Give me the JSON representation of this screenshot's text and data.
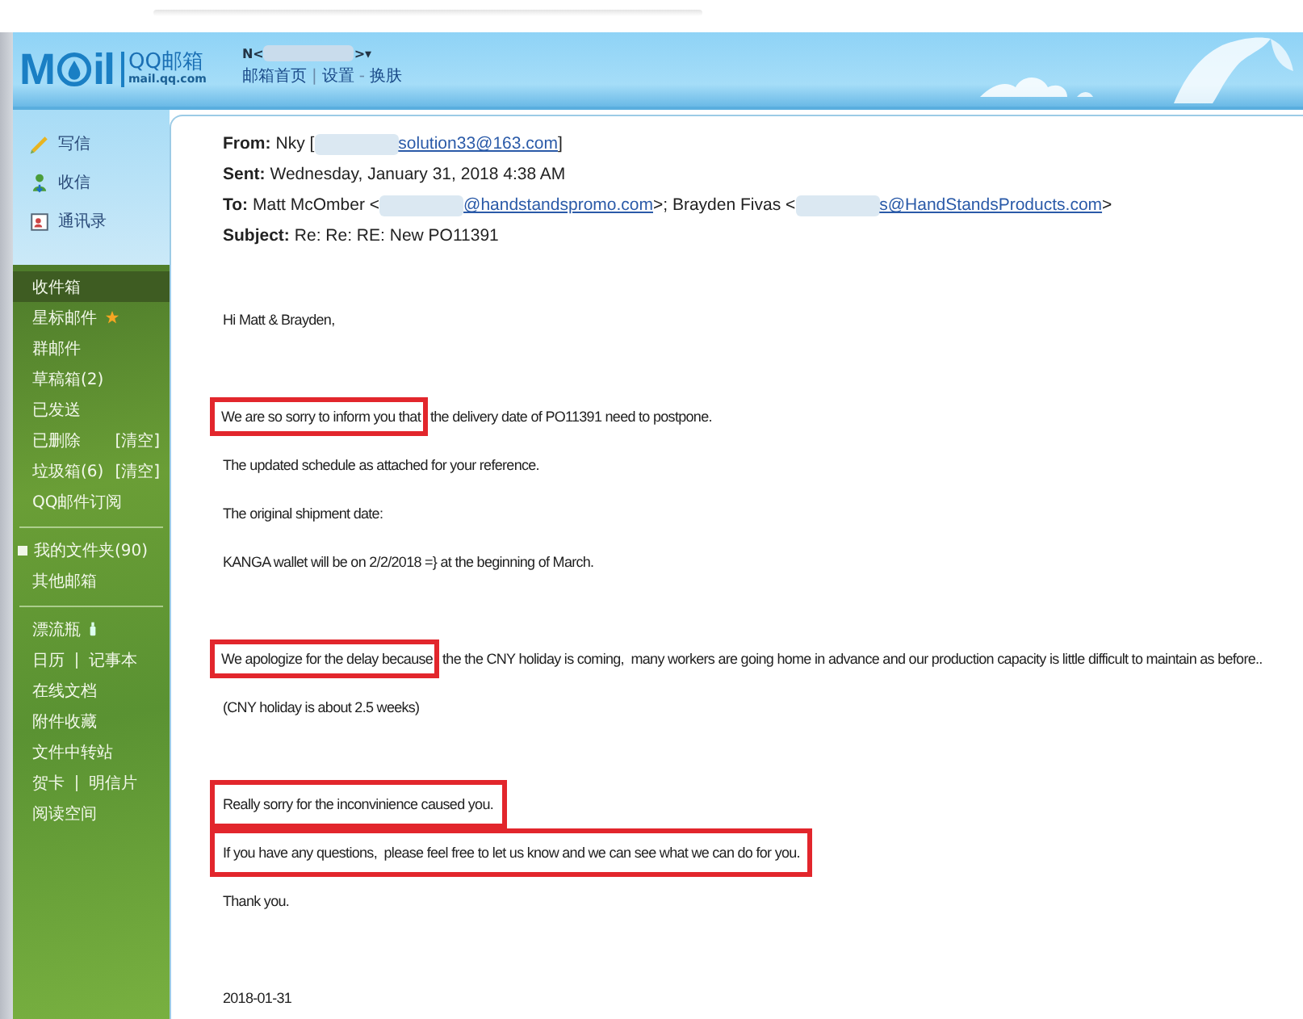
{
  "header": {
    "logo_left": "M",
    "logo_right": "il",
    "brand": "QQ邮箱",
    "domain": "mail.qq.com",
    "account_left": "N<",
    "account_right": ">▾",
    "nav": [
      {
        "kind": "link",
        "text": "邮箱首页"
      },
      {
        "kind": "sep",
        "text": "|"
      },
      {
        "kind": "link",
        "text": "设置"
      },
      {
        "kind": "sep",
        "text": "-"
      },
      {
        "kind": "link",
        "text": "换肤"
      }
    ]
  },
  "actions": [
    {
      "kind": "write",
      "label": "写信"
    },
    {
      "kind": "receive",
      "label": "收信"
    },
    {
      "kind": "contacts",
      "label": "通讯录"
    }
  ],
  "folder_groups": [
    {
      "items": [
        {
          "labels": [
            "收件箱"
          ],
          "selected": true
        },
        {
          "labels": [
            "星标邮件"
          ],
          "selected": false,
          "star": true
        },
        {
          "labels": [
            "群邮件"
          ],
          "selected": false
        },
        {
          "labels": [
            "草稿箱(2)"
          ],
          "selected": false
        },
        {
          "labels": [
            "已发送"
          ],
          "selected": false
        },
        {
          "labels": [
            "已删除"
          ],
          "selected": false,
          "action": "[清空]"
        },
        {
          "labels": [
            "垃圾箱(6)"
          ],
          "selected": false,
          "action": "[清空]"
        },
        {
          "labels": [
            "QQ邮件订阅"
          ],
          "selected": false
        }
      ]
    },
    {
      "items": [
        {
          "labels": [
            "我的文件夹(90)"
          ],
          "selected": false,
          "expandable": true
        },
        {
          "labels": [
            "其他邮箱"
          ],
          "selected": false
        }
      ]
    },
    {
      "items": [
        {
          "labels": [
            "漂流瓶"
          ],
          "selected": false,
          "bottle": true
        },
        {
          "labels": [
            "日历",
            "记事本"
          ],
          "selected": false
        },
        {
          "labels": [
            "在线文档"
          ],
          "selected": false
        },
        {
          "labels": [
            "附件收藏"
          ],
          "selected": false
        },
        {
          "labels": [
            "文件中转站"
          ],
          "selected": false
        },
        {
          "labels": [
            "贺卡",
            "明信片"
          ],
          "selected": false
        },
        {
          "labels": [
            "阅读空间"
          ],
          "selected": false
        }
      ]
    }
  ],
  "email": {
    "fields": [
      {
        "label": "From:",
        "parts": [
          {
            "kind": "text",
            "text": "Nky ["
          },
          {
            "kind": "redacted"
          },
          {
            "kind": "link",
            "text": "solution33@163.com"
          },
          {
            "kind": "text",
            "text": "]"
          }
        ]
      },
      {
        "label": "Sent:",
        "parts": [
          {
            "kind": "text",
            "text": "Wednesday, January 31, 2018 4:38 AM"
          }
        ]
      },
      {
        "label": "To:",
        "parts": [
          {
            "kind": "text",
            "text": "Matt McOmber <"
          },
          {
            "kind": "redacted"
          },
          {
            "kind": "link",
            "text": "@handstandspromo.com"
          },
          {
            "kind": "text",
            "text": ">; Brayden Fivas <"
          },
          {
            "kind": "redacted"
          },
          {
            "kind": "link",
            "text": "s@HandStandsProducts.com"
          },
          {
            "kind": "text",
            "text": ">"
          }
        ]
      },
      {
        "label": "Subject:",
        "parts": [
          {
            "kind": "text",
            "text": "Re: Re: RE: New PO11391"
          }
        ]
      }
    ],
    "body": [
      [
        {
          "text": "Hi Matt & Brayden,"
        }
      ],
      [
        {
          "highlight": "We are so sorry to inform you that",
          "text": "the delivery date of PO11391 need to postpone."
        },
        {
          "text": "The updated schedule as attached for your reference."
        },
        {
          "text": "The original shipment date:"
        },
        {
          "text": "KANGA wallet will be on 2/2/2018 =} at the beginning of March."
        }
      ],
      [
        {
          "highlight": "We apologize for the delay because",
          "text": "the the CNY holiday is coming,  many workers are going home in advance and our production capacity is little difficult to maintain as before.."
        },
        {
          "text": "(CNY holiday is about 2.5 weeks)"
        }
      ],
      [
        {
          "highlight_line": true,
          "text": "Really sorry for the inconvinience caused you."
        },
        {
          "highlight_line": true,
          "text": "If you have any questions,  please feel free to let us know and we can see what we can do for you."
        },
        {
          "text": "Thank you."
        }
      ],
      [
        {
          "text": "2018-01-31"
        }
      ]
    ]
  }
}
